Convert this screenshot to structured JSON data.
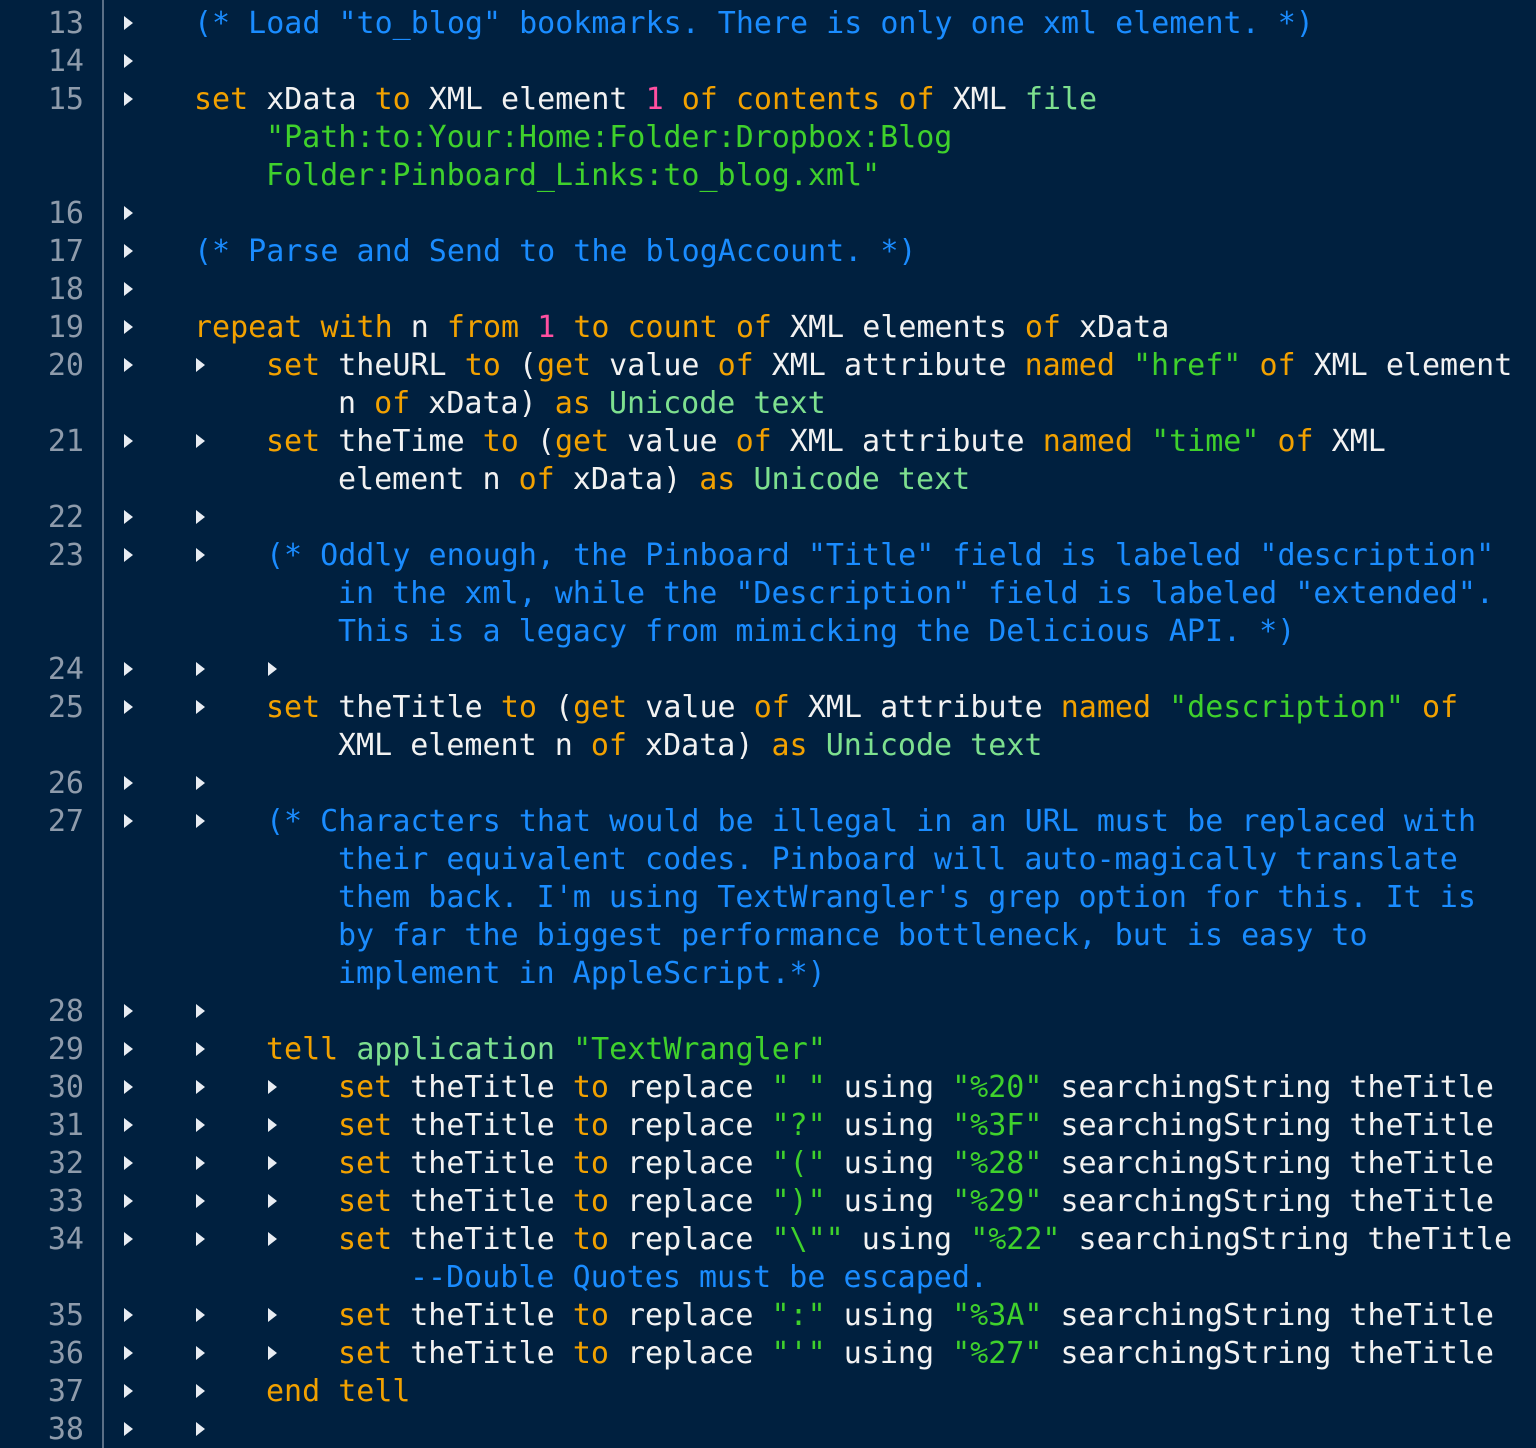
{
  "editor": {
    "theme_colors": {
      "background": "#00203f",
      "keyword": "#f2a100",
      "identifier": "#f2f2f2",
      "number": "#ff4fa0",
      "string": "#3fd12c",
      "app_term": "#7de08f",
      "comment": "#1a8cff",
      "line_number": "#8e9bab"
    },
    "lines": [
      {
        "number": "13",
        "indent": 1,
        "visual_lines": [
          [
            [
              "cmt",
              "(* Load \"to_blog\" bookmarks. There is only one xml element. *)"
            ]
          ]
        ]
      },
      {
        "number": "14",
        "indent": 1,
        "visual_lines": [
          []
        ]
      },
      {
        "number": "15",
        "indent": 1,
        "visual_lines": [
          [
            [
              "kw",
              "set"
            ],
            [
              "id",
              " xData "
            ],
            [
              "kw",
              "to"
            ],
            [
              "id",
              " XML element "
            ],
            [
              "num",
              "1"
            ],
            [
              "id",
              " "
            ],
            [
              "kw",
              "of"
            ],
            [
              "id",
              " "
            ],
            [
              "kw",
              "contents"
            ],
            [
              "id",
              " "
            ],
            [
              "kw",
              "of"
            ],
            [
              "id",
              " XML "
            ],
            [
              "app",
              "file"
            ]
          ],
          [
            [
              "str",
              "\"Path:to:Your:Home:Folder:Dropbox:Blog"
            ]
          ],
          [
            [
              "str",
              "Folder:Pinboard_Links:to_blog.xml\""
            ]
          ]
        ]
      },
      {
        "number": "16",
        "indent": 1,
        "visual_lines": [
          []
        ]
      },
      {
        "number": "17",
        "indent": 1,
        "visual_lines": [
          [
            [
              "cmt",
              "(* Parse and Send to the blogAccount. *)"
            ]
          ]
        ]
      },
      {
        "number": "18",
        "indent": 1,
        "visual_lines": [
          []
        ]
      },
      {
        "number": "19",
        "indent": 1,
        "visual_lines": [
          [
            [
              "kw",
              "repeat"
            ],
            [
              "id",
              " "
            ],
            [
              "kw",
              "with"
            ],
            [
              "id",
              " n "
            ],
            [
              "kw",
              "from"
            ],
            [
              "id",
              " "
            ],
            [
              "num",
              "1"
            ],
            [
              "id",
              " "
            ],
            [
              "kw",
              "to"
            ],
            [
              "id",
              " "
            ],
            [
              "kw",
              "count"
            ],
            [
              "id",
              " "
            ],
            [
              "kw",
              "of"
            ],
            [
              "id",
              " XML elements "
            ],
            [
              "kw",
              "of"
            ],
            [
              "id",
              " xData"
            ]
          ]
        ]
      },
      {
        "number": "20",
        "indent": 2,
        "visual_lines": [
          [
            [
              "kw",
              "set"
            ],
            [
              "id",
              " theURL "
            ],
            [
              "kw",
              "to"
            ],
            [
              "id",
              " ("
            ],
            [
              "kw",
              "get"
            ],
            [
              "id",
              " value "
            ],
            [
              "kw",
              "of"
            ],
            [
              "id",
              " XML attribute "
            ],
            [
              "kw",
              "named"
            ],
            [
              "id",
              " "
            ],
            [
              "str",
              "\"href\""
            ],
            [
              "id",
              " "
            ],
            [
              "kw",
              "of"
            ],
            [
              "id",
              " XML element"
            ]
          ],
          [
            [
              "id",
              "n "
            ],
            [
              "kw",
              "of"
            ],
            [
              "id",
              " xData) "
            ],
            [
              "kw",
              "as"
            ],
            [
              "id",
              " "
            ],
            [
              "app",
              "Unicode text"
            ]
          ]
        ]
      },
      {
        "number": "21",
        "indent": 2,
        "visual_lines": [
          [
            [
              "kw",
              "set"
            ],
            [
              "id",
              " theTime "
            ],
            [
              "kw",
              "to"
            ],
            [
              "id",
              " ("
            ],
            [
              "kw",
              "get"
            ],
            [
              "id",
              " value "
            ],
            [
              "kw",
              "of"
            ],
            [
              "id",
              " XML attribute "
            ],
            [
              "kw",
              "named"
            ],
            [
              "id",
              " "
            ],
            [
              "str",
              "\"time\""
            ],
            [
              "id",
              " "
            ],
            [
              "kw",
              "of"
            ],
            [
              "id",
              " XML"
            ]
          ],
          [
            [
              "id",
              "element n "
            ],
            [
              "kw",
              "of"
            ],
            [
              "id",
              " xData) "
            ],
            [
              "kw",
              "as"
            ],
            [
              "id",
              " "
            ],
            [
              "app",
              "Unicode text"
            ]
          ]
        ]
      },
      {
        "number": "22",
        "indent": 2,
        "visual_lines": [
          []
        ]
      },
      {
        "number": "23",
        "indent": 2,
        "visual_lines": [
          [
            [
              "cmt",
              "(* Oddly enough, the Pinboard \"Title\" field is labeled \"description\""
            ]
          ],
          [
            [
              "cmt",
              "in the xml, while the \"Description\" field is labeled \"extended\"."
            ]
          ],
          [
            [
              "cmt",
              "This is a legacy from mimicking the Delicious API. *)"
            ]
          ]
        ]
      },
      {
        "number": "24",
        "indent": 3,
        "visual_lines": [
          []
        ]
      },
      {
        "number": "25",
        "indent": 2,
        "visual_lines": [
          [
            [
              "kw",
              "set"
            ],
            [
              "id",
              " theTitle "
            ],
            [
              "kw",
              "to"
            ],
            [
              "id",
              " ("
            ],
            [
              "kw",
              "get"
            ],
            [
              "id",
              " value "
            ],
            [
              "kw",
              "of"
            ],
            [
              "id",
              " XML attribute "
            ],
            [
              "kw",
              "named"
            ],
            [
              "id",
              " "
            ],
            [
              "str",
              "\"description\""
            ],
            [
              "id",
              " "
            ],
            [
              "kw",
              "of"
            ]
          ],
          [
            [
              "id",
              "XML element n "
            ],
            [
              "kw",
              "of"
            ],
            [
              "id",
              " xData) "
            ],
            [
              "kw",
              "as"
            ],
            [
              "id",
              " "
            ],
            [
              "app",
              "Unicode text"
            ]
          ]
        ]
      },
      {
        "number": "26",
        "indent": 2,
        "visual_lines": [
          []
        ]
      },
      {
        "number": "27",
        "indent": 2,
        "visual_lines": [
          [
            [
              "cmt",
              "(* Characters that would be illegal in an URL must be replaced with"
            ]
          ],
          [
            [
              "cmt",
              "their equivalent codes. Pinboard will auto-magically translate"
            ]
          ],
          [
            [
              "cmt",
              "them back. I'm using TextWrangler's grep option for this. It is"
            ]
          ],
          [
            [
              "cmt",
              "by far the biggest performance bottleneck, but is easy to"
            ]
          ],
          [
            [
              "cmt",
              "implement in AppleScript.*)"
            ]
          ]
        ]
      },
      {
        "number": "28",
        "indent": 2,
        "visual_lines": [
          []
        ]
      },
      {
        "number": "29",
        "indent": 2,
        "visual_lines": [
          [
            [
              "kw",
              "tell"
            ],
            [
              "id",
              " "
            ],
            [
              "app",
              "application"
            ],
            [
              "id",
              " "
            ],
            [
              "str",
              "\"TextWrangler\""
            ]
          ]
        ]
      },
      {
        "number": "30",
        "indent": 3,
        "visual_lines": [
          [
            [
              "kw",
              "set"
            ],
            [
              "id",
              " theTitle "
            ],
            [
              "kw",
              "to"
            ],
            [
              "id",
              " replace "
            ],
            [
              "str",
              "\" \""
            ],
            [
              "id",
              " using "
            ],
            [
              "str",
              "\"%20\""
            ],
            [
              "id",
              " searchingString theTitle"
            ]
          ]
        ]
      },
      {
        "number": "31",
        "indent": 3,
        "visual_lines": [
          [
            [
              "kw",
              "set"
            ],
            [
              "id",
              " theTitle "
            ],
            [
              "kw",
              "to"
            ],
            [
              "id",
              " replace "
            ],
            [
              "str",
              "\"?\""
            ],
            [
              "id",
              " using "
            ],
            [
              "str",
              "\"%3F\""
            ],
            [
              "id",
              " searchingString theTitle"
            ]
          ]
        ]
      },
      {
        "number": "32",
        "indent": 3,
        "visual_lines": [
          [
            [
              "kw",
              "set"
            ],
            [
              "id",
              " theTitle "
            ],
            [
              "kw",
              "to"
            ],
            [
              "id",
              " replace "
            ],
            [
              "str",
              "\"(\""
            ],
            [
              "id",
              " using "
            ],
            [
              "str",
              "\"%28\""
            ],
            [
              "id",
              " searchingString theTitle"
            ]
          ]
        ]
      },
      {
        "number": "33",
        "indent": 3,
        "visual_lines": [
          [
            [
              "kw",
              "set"
            ],
            [
              "id",
              " theTitle "
            ],
            [
              "kw",
              "to"
            ],
            [
              "id",
              " replace "
            ],
            [
              "str",
              "\")\""
            ],
            [
              "id",
              " using "
            ],
            [
              "str",
              "\"%29\""
            ],
            [
              "id",
              " searchingString theTitle"
            ]
          ]
        ]
      },
      {
        "number": "34",
        "indent": 3,
        "visual_lines": [
          [
            [
              "kw",
              "set"
            ],
            [
              "id",
              " theTitle "
            ],
            [
              "kw",
              "to"
            ],
            [
              "id",
              " replace "
            ],
            [
              "str",
              "\"\\\"\""
            ],
            [
              "id",
              " using "
            ],
            [
              "str",
              "\"%22\""
            ],
            [
              "id",
              " searchingString theTitle"
            ]
          ],
          [
            [
              "cmt",
              "--Double Quotes must be escaped."
            ]
          ]
        ]
      },
      {
        "number": "35",
        "indent": 3,
        "visual_lines": [
          [
            [
              "kw",
              "set"
            ],
            [
              "id",
              " theTitle "
            ],
            [
              "kw",
              "to"
            ],
            [
              "id",
              " replace "
            ],
            [
              "str",
              "\":\""
            ],
            [
              "id",
              " using "
            ],
            [
              "str",
              "\"%3A\""
            ],
            [
              "id",
              " searchingString theTitle"
            ]
          ]
        ]
      },
      {
        "number": "36",
        "indent": 3,
        "visual_lines": [
          [
            [
              "kw",
              "set"
            ],
            [
              "id",
              " theTitle "
            ],
            [
              "kw",
              "to"
            ],
            [
              "id",
              " replace "
            ],
            [
              "str",
              "\"'\""
            ],
            [
              "id",
              " using "
            ],
            [
              "str",
              "\"%27\""
            ],
            [
              "id",
              " searchingString theTitle"
            ]
          ]
        ]
      },
      {
        "number": "37",
        "indent": 2,
        "visual_lines": [
          [
            [
              "kw",
              "end"
            ],
            [
              "id",
              " "
            ],
            [
              "kw",
              "tell"
            ]
          ]
        ]
      },
      {
        "number": "38",
        "indent": 2,
        "visual_lines": [
          []
        ]
      }
    ]
  }
}
